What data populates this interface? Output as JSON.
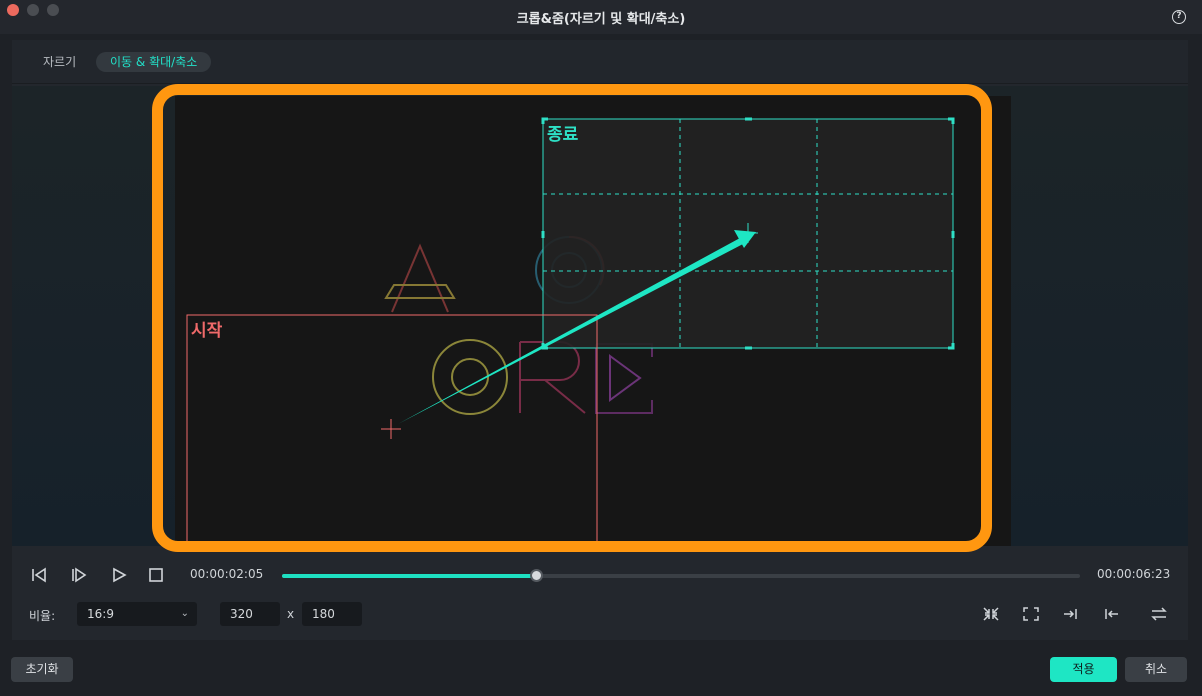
{
  "window": {
    "title": "크롭&줌(자르기 및 확대/축소)",
    "help": "?"
  },
  "tabs": [
    {
      "label": "자르기",
      "active": false
    },
    {
      "label": "이동 & 확대/축소",
      "active": true
    }
  ],
  "preview": {
    "start_label": "시작",
    "end_label": "종료",
    "logo_letters": {
      "a": "A",
      "r": "R"
    },
    "colors": {
      "start": "#f06a6a",
      "end": "#2ee0c6",
      "highlight": "#ff9710"
    }
  },
  "playback": {
    "current_time": "00:00:02:05",
    "total_time": "00:00:06:23",
    "progress": 0.318,
    "buttons": [
      "prev-frame-icon",
      "next-frame-icon",
      "play-icon",
      "stop-icon"
    ]
  },
  "settings": {
    "ratio_label": "비율:",
    "ratio_value": "16:9",
    "width": "320",
    "separator": "x",
    "height": "180",
    "tool_icons": [
      "shrink-icon",
      "expand-icon",
      "align-end-icon",
      "align-start-icon",
      "swap-icon"
    ]
  },
  "footer": {
    "reset_label": "초기화",
    "apply_label": "적용",
    "cancel_label": "취소"
  },
  "accent": "#1ee6c4"
}
